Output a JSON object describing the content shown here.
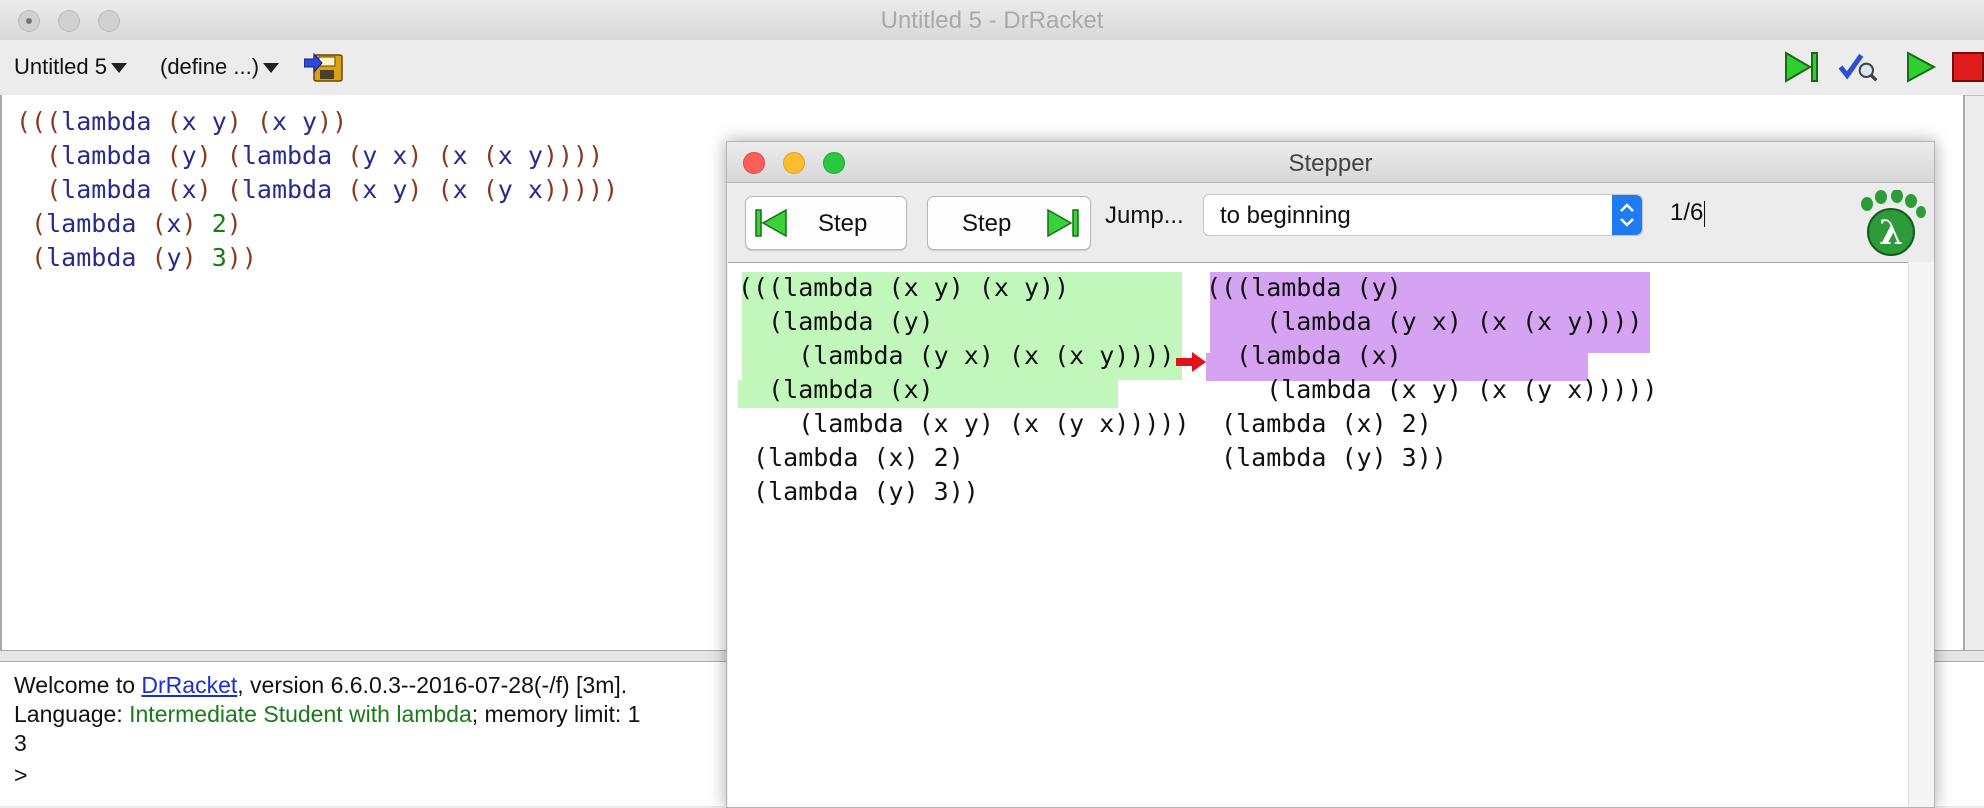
{
  "window": {
    "title": "Untitled 5 - DrRacket"
  },
  "toolbar": {
    "file_menu": "Untitled 5",
    "define_menu": "(define ...)",
    "icons": [
      "save-icon",
      "step-icon",
      "check-syntax-icon",
      "run-icon",
      "stop-icon"
    ]
  },
  "editor": {
    "lines": [
      "(((lambda (x y) (x y))",
      "  (lambda (y) (lambda (y x) (x (x y))))",
      "  (lambda (x) (lambda (x y) (x (y x)))))",
      " (lambda (x) 2)",
      " (lambda (y) 3))"
    ]
  },
  "repl": {
    "welcome_prefix": "Welcome to ",
    "welcome_link": "DrRacket",
    "welcome_suffix": ", version 6.6.0.3--2016-07-28(-/f) [3m].",
    "language_prefix": "Language: ",
    "language_name": "Intermediate Student with lambda",
    "language_suffix": "; memory limit: 1",
    "result": "3",
    "prompt": ">"
  },
  "stepper": {
    "title": "Stepper",
    "back_button": "Step",
    "forward_button": "Step",
    "jump_label": "Jump...",
    "jump_value": "to beginning",
    "counter": "1/6",
    "left_code": [
      "(((lambda (x y) (x y))",
      "  (lambda (y)",
      "    (lambda (y x) (x (x y))))",
      "  (lambda (x)",
      "    (lambda (x y) (x (y x)))))",
      " (lambda (x) 2)",
      " (lambda (y) 3))"
    ],
    "right_code": [
      "(((lambda (y)",
      "    (lambda (y x) (x (x y))))",
      "  (lambda (x)",
      "    (lambda (x y) (x (y x)))))",
      " (lambda (x) 2)",
      " (lambda (y) 3))"
    ],
    "highlight_colors": {
      "before": "#c2f7bc",
      "after": "#d5a3f1",
      "arrow": "#e0141c"
    }
  }
}
